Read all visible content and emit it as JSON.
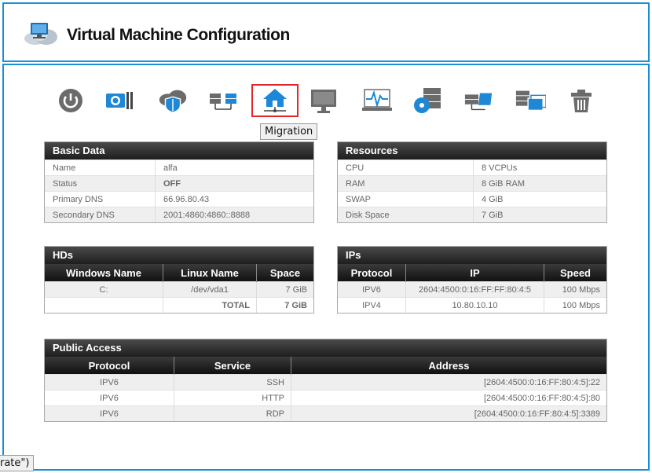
{
  "header": {
    "title": "Virtual Machine Configuration"
  },
  "toolbar": {
    "items": [
      {
        "icon": "power-icon"
      },
      {
        "icon": "camera-tools-icon"
      },
      {
        "icon": "cloud-shield-icon"
      },
      {
        "icon": "servers-network-icon"
      },
      {
        "icon": "home-network-icon"
      },
      {
        "icon": "monitor-icon"
      },
      {
        "icon": "activity-monitor-icon"
      },
      {
        "icon": "server-disc-icon"
      },
      {
        "icon": "server-transfer-icon"
      },
      {
        "icon": "server-copy-icon"
      },
      {
        "icon": "trash-icon"
      }
    ],
    "active_tooltip": "Migration"
  },
  "basic_data": {
    "title": "Basic Data",
    "rows": [
      {
        "k": "Name",
        "v": "alfa"
      },
      {
        "k": "Status",
        "v": "OFF"
      },
      {
        "k": "Primary DNS",
        "v": "66.96.80.43"
      },
      {
        "k": "Secondary DNS",
        "v": "2001:4860:4860::8888"
      }
    ]
  },
  "resources": {
    "title": "Resources",
    "rows": [
      {
        "k": "CPU",
        "v": "8 VCPUs"
      },
      {
        "k": "RAM",
        "v": "8 GiB RAM"
      },
      {
        "k": "SWAP",
        "v": "4 GiB"
      },
      {
        "k": "Disk Space",
        "v": "7 GiB"
      }
    ]
  },
  "hds": {
    "title": "HDs",
    "columns": [
      "Windows Name",
      "Linux Name",
      "Space"
    ],
    "rows": [
      [
        "C:",
        "/dev/vda1",
        "7 GiB"
      ]
    ],
    "total_label": "TOTAL",
    "total_value": "7 GiB"
  },
  "ips": {
    "title": "IPs",
    "columns": [
      "Protocol",
      "IP",
      "Speed"
    ],
    "rows": [
      [
        "IPV6",
        "2604:4500:0:16:FF:FF:80:4:5",
        "100 Mbps"
      ],
      [
        "IPV4",
        "10.80.10.10",
        "100 Mbps"
      ]
    ]
  },
  "public_access": {
    "title": "Public Access",
    "columns": [
      "Protocol",
      "Service",
      "Address"
    ],
    "rows": [
      [
        "IPV6",
        "SSH",
        "[2604:4500:0:16:FF:80:4:5]:22"
      ],
      [
        "IPV6",
        "HTTP",
        "[2604:4500:0:16:FF:80:4:5]:80"
      ],
      [
        "IPV6",
        "RDP",
        "[2604:4500:0:16:FF:80:4:5]:3389"
      ]
    ]
  },
  "status_bar": {
    "text": "rate\")"
  },
  "colors": {
    "accent": "#1a8fd6",
    "active_outline": "#e0282a",
    "icon_blue": "#1e88d6",
    "icon_gray": "#6b6b6b"
  }
}
